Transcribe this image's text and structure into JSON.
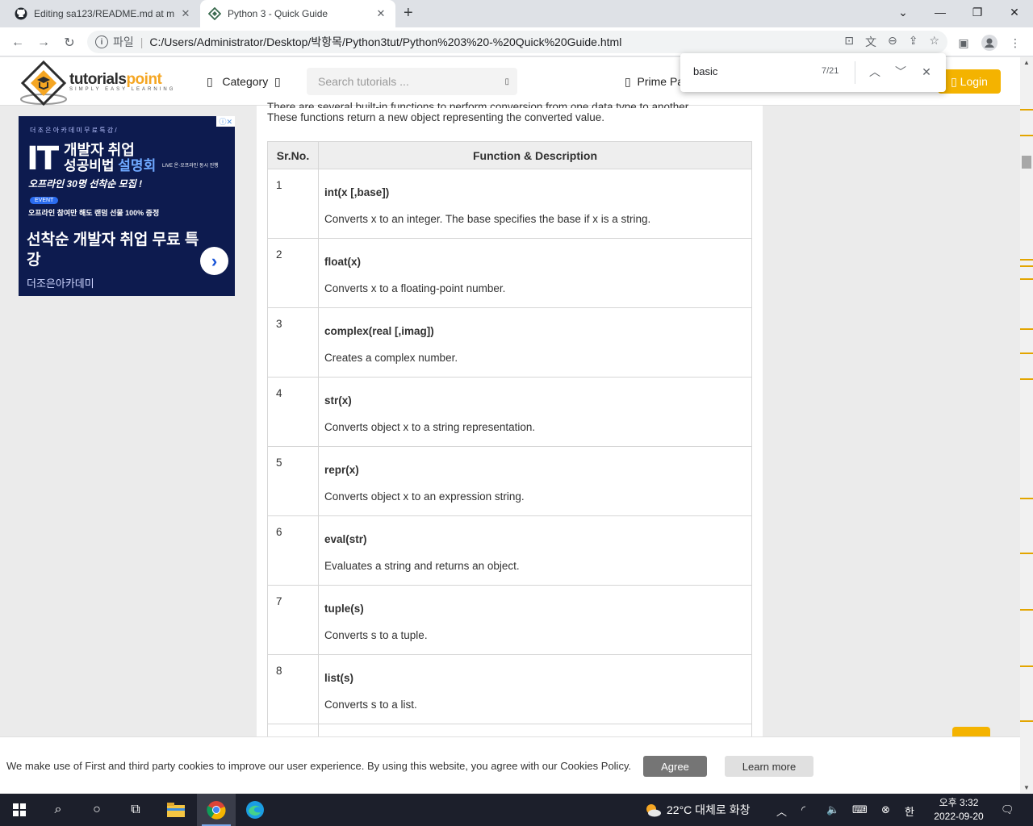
{
  "browser": {
    "tabs": [
      {
        "title": "Editing sa123/README.md at m",
        "icon": "github-icon"
      },
      {
        "title": "Python 3 - Quick Guide",
        "icon": "tutorialspoint-favicon"
      }
    ],
    "new_tab": "+",
    "address": {
      "scheme_label": "파일",
      "separator": "|",
      "url": "C:/Users/Administrator/Desktop/박항목/Python3tut/Python%203%20-%20Quick%20Guide.html"
    },
    "find": {
      "query": "basic",
      "count": "7/21"
    }
  },
  "site": {
    "logo_name_a": "tutorials",
    "logo_name_b": "point",
    "logo_tagline": "SIMPLY EASY LEARNING",
    "category": "Category",
    "search_placeholder": "Search tutorials ...",
    "prime": "Prime Pa",
    "login": "Login"
  },
  "ad": {
    "top_text": "더 조 은 아 카 데 미 무 료 특 강 /",
    "it": "IT",
    "line1": "개발자 취업",
    "line2a": "성공비법 ",
    "line2b": "설명회",
    "live": "LIVE 온·오프라인 동시 진행",
    "line3": "오프라인 30명 선착순 모집 !",
    "event": "EVENT",
    "line4": "오프라인 참여만 해도 랜덤 선물 100% 증정",
    "headline": "선착순 개발자 취업 무료 특강",
    "sponsor": "더조은아카데미"
  },
  "content": {
    "intro_cut": "There are several built-in functions to perform conversion from one data type to another.",
    "intro": "These functions return a new object representing the converted value.",
    "table": {
      "headers": [
        "Sr.No.",
        "Function & Description"
      ],
      "rows": [
        {
          "no": "1",
          "fn": "int(x [,base])",
          "desc": "Converts x to an integer. The base specifies the base if x is a string."
        },
        {
          "no": "2",
          "fn": "float(x)",
          "desc": "Converts x to a floating-point number."
        },
        {
          "no": "3",
          "fn": "complex(real [,imag])",
          "desc": "Creates a complex number."
        },
        {
          "no": "4",
          "fn": "str(x)",
          "desc": "Converts object x to a string representation."
        },
        {
          "no": "5",
          "fn": "repr(x)",
          "desc": "Converts object x to an expression string."
        },
        {
          "no": "6",
          "fn": "eval(str)",
          "desc": "Evaluates a string and returns an object."
        },
        {
          "no": "7",
          "fn": "tuple(s)",
          "desc": "Converts s to a tuple."
        },
        {
          "no": "8",
          "fn": "list(s)",
          "desc": "Converts s to a list."
        }
      ]
    }
  },
  "cookie": {
    "message": "We make use of First and third party cookies to improve our user experience. By using this website, you agree with our Cookies Policy.",
    "agree": "Agree",
    "learn_more": "Learn more"
  },
  "taskbar": {
    "weather": "22°C  대체로 화창",
    "ime": "한",
    "time": "오후 3:32",
    "date": "2022-09-20"
  },
  "colors": {
    "accent": "#f4b300",
    "ad_bg": "#0d1b4f"
  }
}
